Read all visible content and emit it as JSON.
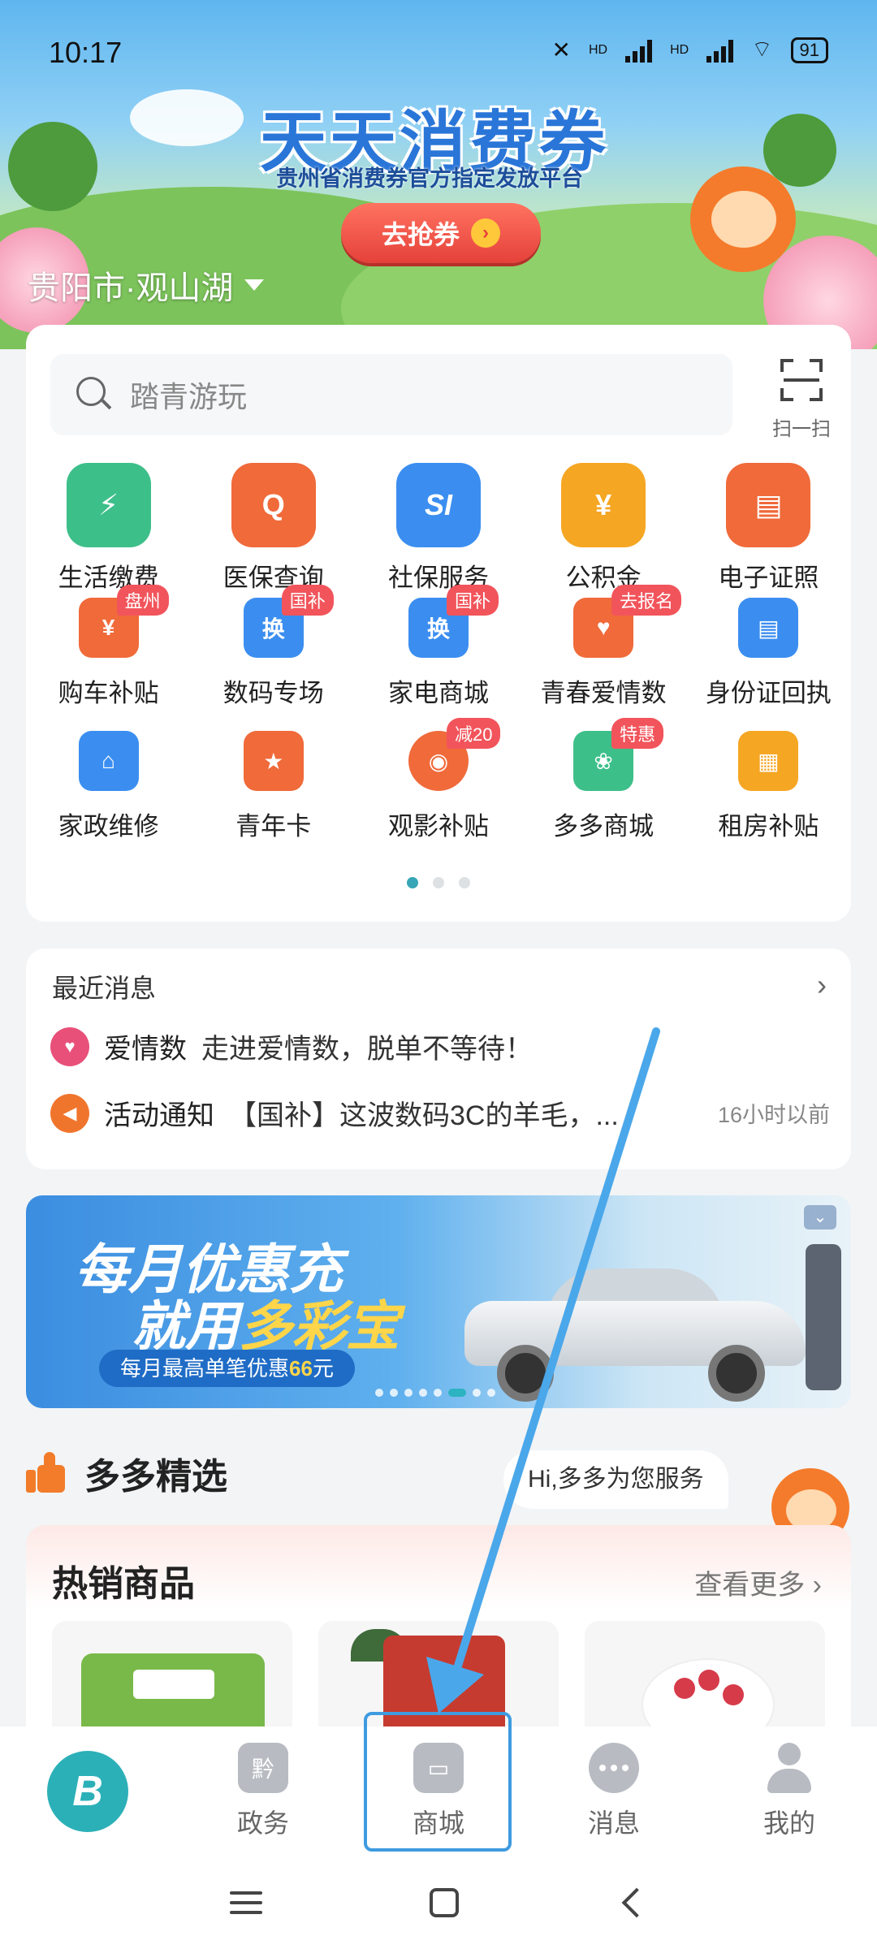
{
  "status_bar": {
    "time": "10:17",
    "network1": "HD",
    "network2": "HD",
    "battery": "91"
  },
  "banner": {
    "title": "天天消费券",
    "subtitle": "贵州省消费券官方指定发放平台",
    "cta_label": "去抢券",
    "location": "贵阳市·观山湖"
  },
  "search": {
    "placeholder": "踏青游玩",
    "scan_label": "扫一扫"
  },
  "services": {
    "row1": [
      {
        "label": "生活缴费",
        "icon": "bolt-icon",
        "color": "#3dbf8a"
      },
      {
        "label": "医保查询",
        "icon": "medical-search-icon",
        "color": "#f06a3a"
      },
      {
        "label": "社保服务",
        "icon": "social-security-icon",
        "color": "#3b8ef0"
      },
      {
        "label": "公积金",
        "icon": "house-fund-icon",
        "color": "#f5a623"
      },
      {
        "label": "电子证照",
        "icon": "id-card-icon",
        "color": "#f06a3a"
      }
    ],
    "row2": [
      {
        "label": "购车补贴",
        "icon": "car-subsidy-icon",
        "color": "#f06a3a",
        "badge": "盘州"
      },
      {
        "label": "数码专场",
        "icon": "digital-icon",
        "color": "#3b8ef0",
        "badge": "国补"
      },
      {
        "label": "家电商城",
        "icon": "appliance-icon",
        "color": "#3b8ef0",
        "badge": "国补"
      },
      {
        "label": "青春爱情数",
        "icon": "heart-shield-icon",
        "color": "#f06a3a",
        "badge": "去报名"
      },
      {
        "label": "身份证回执",
        "icon": "id-receipt-icon",
        "color": "#3b8ef0"
      }
    ],
    "row3": [
      {
        "label": "家政维修",
        "icon": "home-repair-icon",
        "color": "#3b8ef0"
      },
      {
        "label": "青年卡",
        "icon": "youth-card-icon",
        "color": "#f06a3a"
      },
      {
        "label": "观影补贴",
        "icon": "film-reel-icon",
        "color": "#f06a3a",
        "badge": "减20"
      },
      {
        "label": "多多商城",
        "icon": "shop-leaf-icon",
        "color": "#3dbf8a",
        "badge": "特惠"
      },
      {
        "label": "租房补贴",
        "icon": "rent-doc-icon",
        "color": "#f5a623"
      }
    ]
  },
  "messages": {
    "header": "最近消息",
    "items": [
      {
        "source": "爱情数",
        "text": "走进爱情数，脱单不等待！",
        "time": "",
        "icon": "heart-icon",
        "color": "#e8507a"
      },
      {
        "source": "活动通知",
        "text": "【国补】这波数码3C的羊毛，...",
        "time": "16小时以前",
        "icon": "speaker-icon",
        "color": "#f0752c"
      }
    ]
  },
  "promo": {
    "line1": "每月优惠充",
    "line2_prefix": "就用",
    "line2_highlight": "多彩宝",
    "pill_prefix": "每月最高单笔优惠",
    "pill_amount": "66",
    "pill_suffix": "元"
  },
  "selection": {
    "title": "多多精选",
    "assistant_bubble": "Hi,多多为您服务",
    "hot_title": "热销商品",
    "see_more": "查看更多"
  },
  "tabs": [
    {
      "label": "",
      "icon": "app-logo-icon"
    },
    {
      "label": "政务",
      "icon": "government-icon"
    },
    {
      "label": "商城",
      "icon": "store-icon"
    },
    {
      "label": "消息",
      "icon": "chat-bubble-icon"
    },
    {
      "label": "我的",
      "icon": "user-icon"
    }
  ]
}
